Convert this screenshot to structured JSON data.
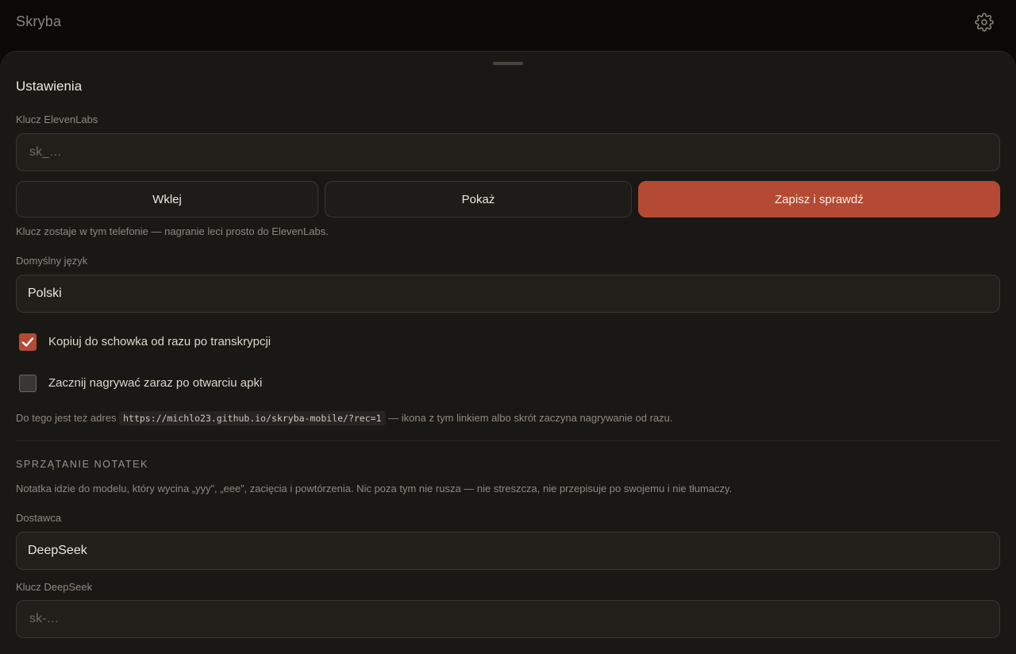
{
  "app": {
    "title": "Skryba",
    "settings_icon": "gear-icon"
  },
  "sheet": {
    "title": "Ustawienia",
    "elevenlabs": {
      "label": "Klucz ElevenLabs",
      "placeholder": "sk_…",
      "paste_label": "Wklej",
      "show_label": "Pokaż",
      "save_label": "Zapisz i sprawdź",
      "hint": "Klucz zostaje w tym telefonie — nagranie leci prosto do ElevenLabs."
    },
    "language": {
      "label": "Domyślny język",
      "value": "Polski"
    },
    "options": [
      {
        "label": "Kopiuj do schowka od razu po transkrypcji",
        "checked": true
      },
      {
        "label": "Zacznij nagrywać zaraz po otwarciu apki",
        "checked": false
      }
    ],
    "url_hint": {
      "before": "Do tego jest też adres",
      "url": "https://michlo23.github.io/skryba-mobile/?rec=1",
      "after": "— ikona z tym linkiem albo skrót zaczyna nagrywanie od razu."
    },
    "cleanup": {
      "heading": "SPRZĄTANIE NOTATEK",
      "description": "Notatka idzie do modelu, który wycina „yyy”, „eee”, zacięcia i powtórzenia. Nic poza tym nie rusza — nie streszcza, nie przepisuje po swojemu i nie tłumaczy.",
      "provider_label": "Dostawca",
      "provider_value": "DeepSeek",
      "key_label": "Klucz DeepSeek",
      "key_placeholder": "sk-…"
    }
  },
  "colors": {
    "accent": "#b44a34",
    "background": "#1a1815",
    "topbar": "#0a0908"
  }
}
